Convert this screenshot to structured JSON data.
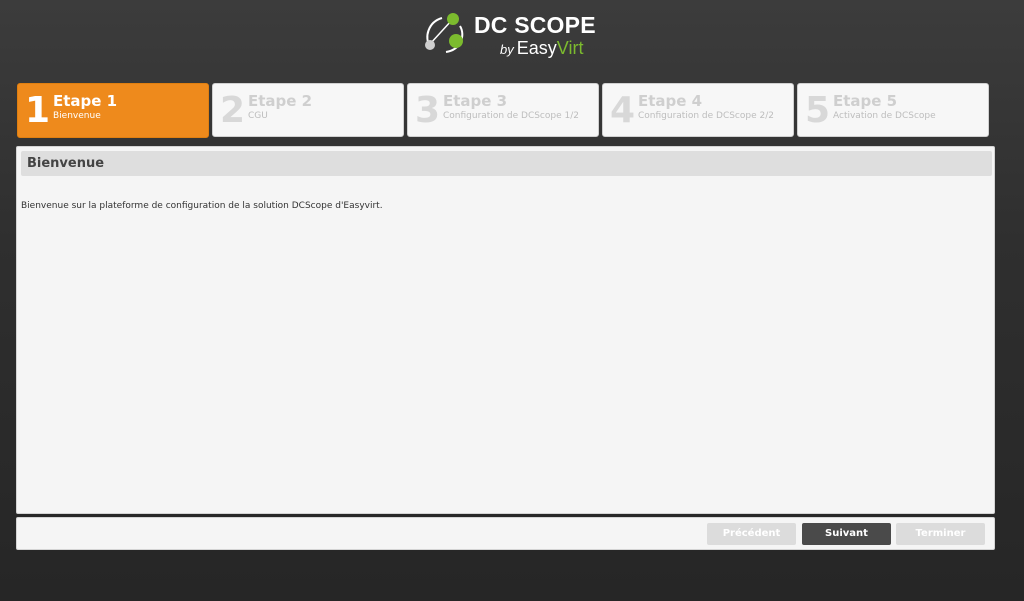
{
  "logo": {
    "title": "DC SCOPE",
    "by": "by",
    "easy": "Easy",
    "virt": "Virt"
  },
  "steps": [
    {
      "number": "1",
      "title": "Etape 1",
      "subtitle": "Bienvenue",
      "active": true
    },
    {
      "number": "2",
      "title": "Etape 2",
      "subtitle": "CGU",
      "active": false
    },
    {
      "number": "3",
      "title": "Etape 3",
      "subtitle": "Configuration de DCScope 1/2",
      "active": false
    },
    {
      "number": "4",
      "title": "Etape 4",
      "subtitle": "Configuration de DCScope 2/2",
      "active": false
    },
    {
      "number": "5",
      "title": "Etape 5",
      "subtitle": "Activation de DCScope",
      "active": false
    }
  ],
  "panel": {
    "title": "Bienvenue",
    "text": "Bienvenue sur la plateforme de configuration de la solution DCScope d'Easyvirt."
  },
  "buttons": {
    "previous": "Précédent",
    "next": "Suivant",
    "finish": "Terminer"
  },
  "colors": {
    "accent": "#ee8a1c",
    "brand_green": "#7cbb2e",
    "primary_button": "#4a4a4a",
    "disabled_button": "#dcdcdc"
  }
}
